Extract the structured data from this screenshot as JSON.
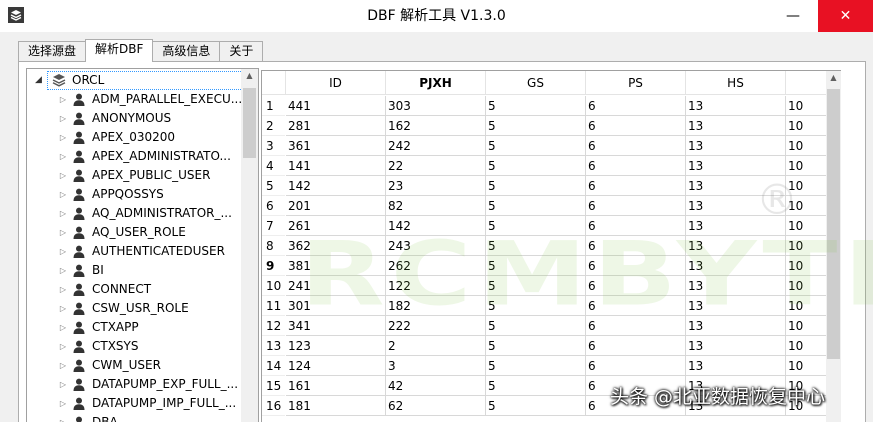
{
  "window": {
    "title": "DBF 解析工具  V1.3.0",
    "app_icon": "stacked-layers-icon",
    "minimize_glyph": "—",
    "close_glyph": "✕"
  },
  "tabs": [
    {
      "label": "选择源盘",
      "active": false
    },
    {
      "label": "解析DBF",
      "active": true
    },
    {
      "label": "高级信息",
      "active": false
    },
    {
      "label": "关于",
      "active": false
    }
  ],
  "tree": {
    "root": {
      "label": "ORCL",
      "icon": "database-icon",
      "expanded": true
    },
    "items": [
      {
        "label": "ADM_PARALLEL_EXECU..."
      },
      {
        "label": "ANONYMOUS"
      },
      {
        "label": "APEX_030200"
      },
      {
        "label": "APEX_ADMINISTRATO..."
      },
      {
        "label": "APEX_PUBLIC_USER"
      },
      {
        "label": "APPQOSSYS"
      },
      {
        "label": "AQ_ADMINISTRATOR_..."
      },
      {
        "label": "AQ_USER_ROLE"
      },
      {
        "label": "AUTHENTICATEDUSER"
      },
      {
        "label": "BI"
      },
      {
        "label": "CONNECT"
      },
      {
        "label": "CSW_USR_ROLE"
      },
      {
        "label": "CTXAPP"
      },
      {
        "label": "CTXSYS"
      },
      {
        "label": "CWM_USER"
      },
      {
        "label": "DATAPUMP_EXP_FULL_..."
      },
      {
        "label": "DATAPUMP_IMP_FULL_..."
      },
      {
        "label": "DBA"
      }
    ]
  },
  "grid": {
    "columns": [
      "ID",
      "PJXH",
      "GS",
      "PS",
      "HS",
      ""
    ],
    "bold_column": "PJXH",
    "rows": [
      {
        "n": "1",
        "cells": [
          "441",
          "303",
          "5",
          "6",
          "13",
          "10"
        ]
      },
      {
        "n": "2",
        "cells": [
          "281",
          "162",
          "5",
          "6",
          "13",
          "10"
        ]
      },
      {
        "n": "3",
        "cells": [
          "361",
          "242",
          "5",
          "6",
          "13",
          "10"
        ]
      },
      {
        "n": "4",
        "cells": [
          "141",
          "22",
          "5",
          "6",
          "13",
          "10"
        ]
      },
      {
        "n": "5",
        "cells": [
          "142",
          "23",
          "5",
          "6",
          "13",
          "10"
        ]
      },
      {
        "n": "6",
        "cells": [
          "201",
          "82",
          "5",
          "6",
          "13",
          "10"
        ]
      },
      {
        "n": "7",
        "cells": [
          "261",
          "142",
          "5",
          "6",
          "13",
          "10"
        ]
      },
      {
        "n": "8",
        "cells": [
          "362",
          "243",
          "5",
          "6",
          "13",
          "10"
        ]
      },
      {
        "n": "9",
        "cells": [
          "381",
          "262",
          "5",
          "6",
          "13",
          "10"
        ],
        "bold_number": true
      },
      {
        "n": "10",
        "cells": [
          "241",
          "122",
          "5",
          "6",
          "13",
          "10"
        ]
      },
      {
        "n": "11",
        "cells": [
          "301",
          "182",
          "5",
          "6",
          "13",
          "10"
        ]
      },
      {
        "n": "12",
        "cells": [
          "341",
          "222",
          "5",
          "6",
          "13",
          "10"
        ]
      },
      {
        "n": "13",
        "cells": [
          "123",
          "2",
          "5",
          "6",
          "13",
          "10"
        ]
      },
      {
        "n": "14",
        "cells": [
          "124",
          "3",
          "5",
          "6",
          "13",
          "10"
        ]
      },
      {
        "n": "15",
        "cells": [
          "161",
          "42",
          "5",
          "6",
          "13",
          "10"
        ]
      },
      {
        "n": "16",
        "cells": [
          "181",
          "62",
          "5",
          "6",
          "13",
          "10"
        ]
      }
    ]
  },
  "watermark": {
    "logo_text": "RCMBYTE",
    "registered_mark": "®",
    "caption": "头条 @北亚数据恢复中心"
  }
}
